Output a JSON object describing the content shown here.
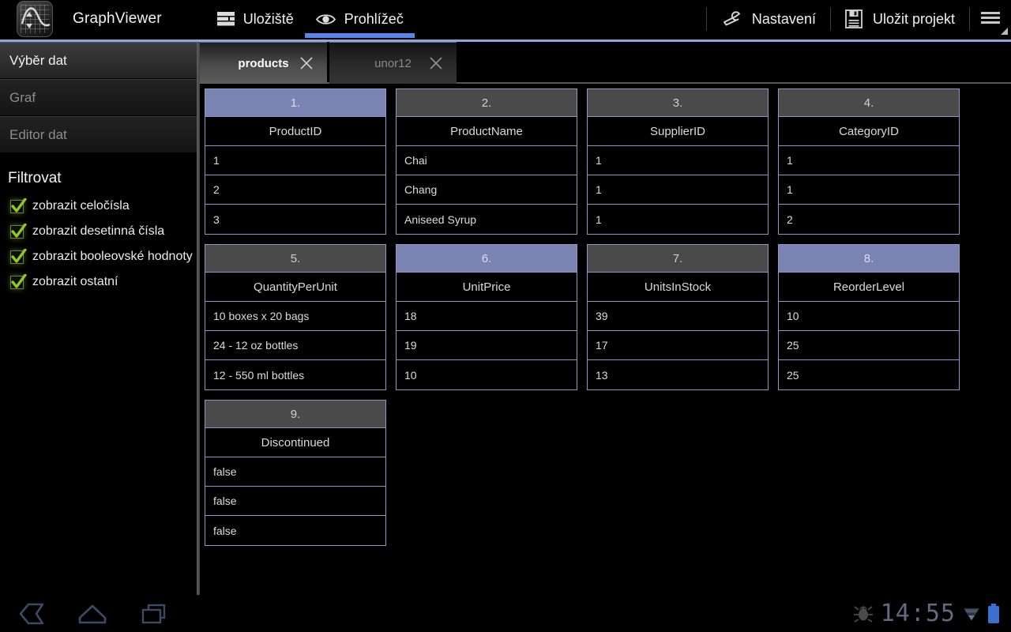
{
  "colors": {
    "accent": "#5a85e8",
    "accent_rule": "#8fa6dd",
    "selected_column": "#7b83b2",
    "grid_border": "#8e96c4",
    "check_green": "#8fc926"
  },
  "actionbar": {
    "app_title": "GraphViewer",
    "logo_icon": "graph-app-icon",
    "tabs": [
      {
        "label": "Uložiště",
        "icon": "storage-icon",
        "active": false
      },
      {
        "label": "Prohlížeč",
        "icon": "eye-icon",
        "active": true
      }
    ],
    "settings": {
      "label": "Nastavení",
      "icon": "wrench-icon"
    },
    "save": {
      "label": "Uložit projekt",
      "icon": "floppy-disk-icon"
    },
    "overflow": {
      "icon": "hamburger-menu-icon"
    }
  },
  "sidebar": {
    "items": [
      {
        "label": "Výběr dat",
        "state": "selected"
      },
      {
        "label": "Graf",
        "state": "disabled"
      },
      {
        "label": "Editor dat",
        "state": "disabled"
      }
    ],
    "filter": {
      "title": "Filtrovat",
      "options": [
        {
          "label": "zobrazit celočísla",
          "checked": true
        },
        {
          "label": "zobrazit desetinná čísla",
          "checked": true
        },
        {
          "label": "zobrazit booleovské hodnoty",
          "checked": true
        },
        {
          "label": "zobrazit ostatní",
          "checked": true
        }
      ]
    }
  },
  "main": {
    "table_tabs": [
      {
        "label": "products",
        "active": true,
        "close_icon": "close-icon"
      },
      {
        "label": "unor12",
        "active": false,
        "close_icon": "close-icon"
      }
    ],
    "columns": [
      {
        "index": "1.",
        "name": "ProductID",
        "selected": true,
        "values": [
          "1",
          "2",
          "3"
        ]
      },
      {
        "index": "2.",
        "name": "ProductName",
        "selected": false,
        "values": [
          "Chai",
          "Chang",
          "Aniseed Syrup"
        ]
      },
      {
        "index": "3.",
        "name": "SupplierID",
        "selected": false,
        "values": [
          "1",
          "1",
          "1"
        ]
      },
      {
        "index": "4.",
        "name": "CategoryID",
        "selected": false,
        "values": [
          "1",
          "1",
          "2"
        ]
      },
      {
        "index": "5.",
        "name": "QuantityPerUnit",
        "selected": false,
        "values": [
          "10 boxes x 20 bags",
          "24 - 12 oz bottles",
          "12 - 550 ml bottles"
        ]
      },
      {
        "index": "6.",
        "name": "UnitPrice",
        "selected": true,
        "values": [
          "18",
          "19",
          "10"
        ]
      },
      {
        "index": "7.",
        "name": "UnitsInStock",
        "selected": false,
        "values": [
          "39",
          "17",
          "13"
        ]
      },
      {
        "index": "8.",
        "name": "ReorderLevel",
        "selected": true,
        "values": [
          "10",
          "25",
          "25"
        ]
      },
      {
        "index": "9.",
        "name": "Discontinued",
        "selected": false,
        "values": [
          "false",
          "false",
          "false"
        ]
      }
    ]
  },
  "systembar": {
    "back_icon": "back-icon",
    "home_icon": "home-icon",
    "recents_icon": "recent-apps-icon",
    "debug_icon": "android-debug-bug-icon",
    "clock": "14:55",
    "wifi_icon": "wifi-icon",
    "battery_icon": "battery-icon"
  }
}
